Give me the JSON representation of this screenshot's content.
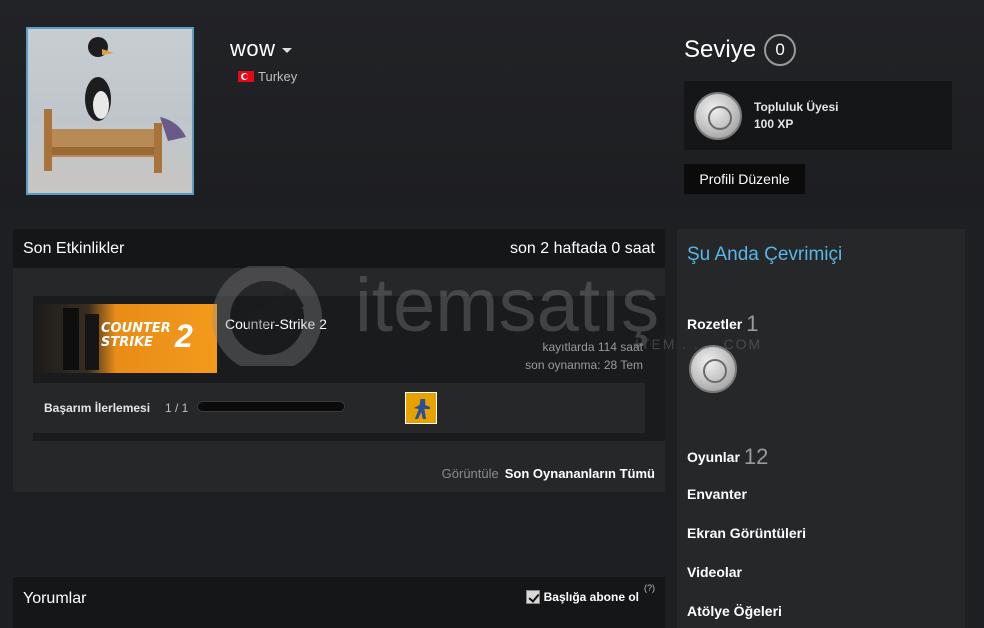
{
  "profile": {
    "name": "wow",
    "country": "Turkey"
  },
  "level": {
    "title": "Seviye",
    "value": "0",
    "badge_name": "Topluluk Üyesi",
    "badge_xp": "100 XP",
    "edit_label": "Profili Düzenle"
  },
  "recent": {
    "title": "Son Etkinlikler",
    "summary": "son 2 haftada 0 saat",
    "game": {
      "art_logo_line1": "COUNTER",
      "art_logo_line2": "STRIKE",
      "art_logo_number": "2",
      "name": "Counter-Strike 2",
      "hours_total": "kayıtlarda 114 saat",
      "last_played": "son oynanma: 28 Tem",
      "achievement_label": "Başarım İlerlemesi",
      "achievement_count": "1 / 1",
      "achievement_progress": 1.0
    },
    "view_label": "Görüntüle",
    "view_all": "Son Oynananların Tümü"
  },
  "comments": {
    "title": "Yorumlar",
    "subscribe_label": "Başlığa abone ol",
    "subscribe_checked": true,
    "help": "(?)"
  },
  "side": {
    "online": "Şu Anda Çevrimiçi",
    "badges_label": "Rozetler",
    "badges_count": "1",
    "games_label": "Oyunlar",
    "games_count": "12",
    "inventory": "Envanter",
    "screenshots": "Ekran Görüntüleri",
    "videos": "Videolar",
    "workshop": "Atölye Öğeleri"
  },
  "watermark": {
    "text": "itemsatış",
    "sub": "ITEM . . . .COM"
  },
  "colors": {
    "accent_blue": "#58b6e8",
    "avatar_border": "#56a0c8",
    "cs2_orange": "#f39a1b"
  }
}
